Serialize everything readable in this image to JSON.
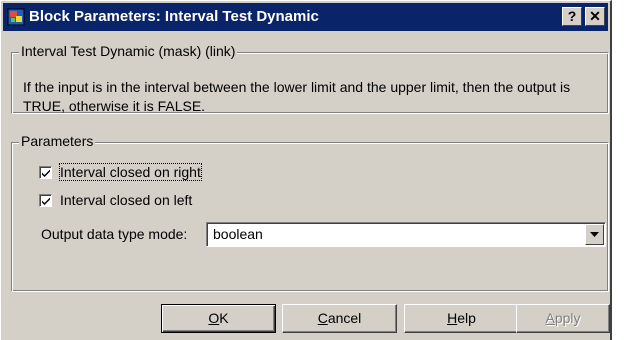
{
  "window": {
    "title": "Block Parameters: Interval Test Dynamic",
    "help_button": "?",
    "close_button": "✕"
  },
  "mask_group": {
    "legend": "Interval Test Dynamic (mask) (link)",
    "description": "If the input is in the interval between the lower limit and the upper limit, then the output is TRUE, otherwise it is FALSE."
  },
  "parameters": {
    "legend": "Parameters",
    "checkboxes": [
      {
        "label": "Interval closed on right",
        "checked": true
      },
      {
        "label": "Interval closed on left",
        "checked": true
      }
    ],
    "output_mode": {
      "label": "Output data type mode:",
      "value": "boolean"
    }
  },
  "buttons": {
    "ok": {
      "mnemonic": "O",
      "rest": "K"
    },
    "cancel": {
      "mnemonic": "C",
      "rest": "ancel"
    },
    "help": {
      "mnemonic": "H",
      "rest": "elp"
    },
    "apply": {
      "mnemonic": "A",
      "rest": "pply"
    }
  },
  "colors": {
    "titlebar": "#0a246a",
    "dialog_face": "#d4d0c8"
  },
  "icons": [
    "simulink-block-icon",
    "help-icon",
    "close-icon",
    "check-icon",
    "chevron-down-icon"
  ]
}
